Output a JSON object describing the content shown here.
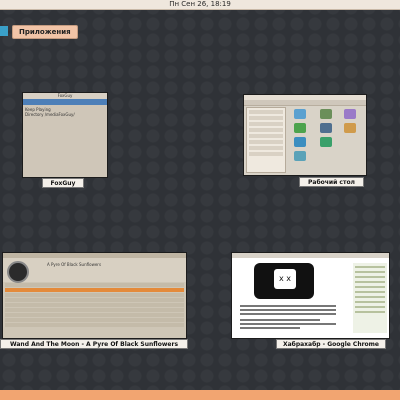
{
  "topbar": {
    "clock": "Пн Сен 26, 18:19"
  },
  "apps_button": {
    "label": "Приложения"
  },
  "windows": [
    {
      "caption": "FoxGuy",
      "inner": {
        "title": "FoxGuy",
        "lines": [
          "Keep Playing",
          "Directory  /mediaFoxGuy/"
        ]
      }
    },
    {
      "caption": "Рабочий стол"
    },
    {
      "caption": "Wand And The Moon - A Pyre Of Black Sunflowers",
      "inner": {
        "track_title": "A Pyre Of Black Sunflowers"
      }
    },
    {
      "caption": "Хабрахабр - Google Chrome",
      "inner": {
        "face": "x x"
      }
    }
  ],
  "colors": {
    "accent": "#3aa0c8",
    "bottom_bar": "#f2a571",
    "selection": "#e48a3a"
  }
}
